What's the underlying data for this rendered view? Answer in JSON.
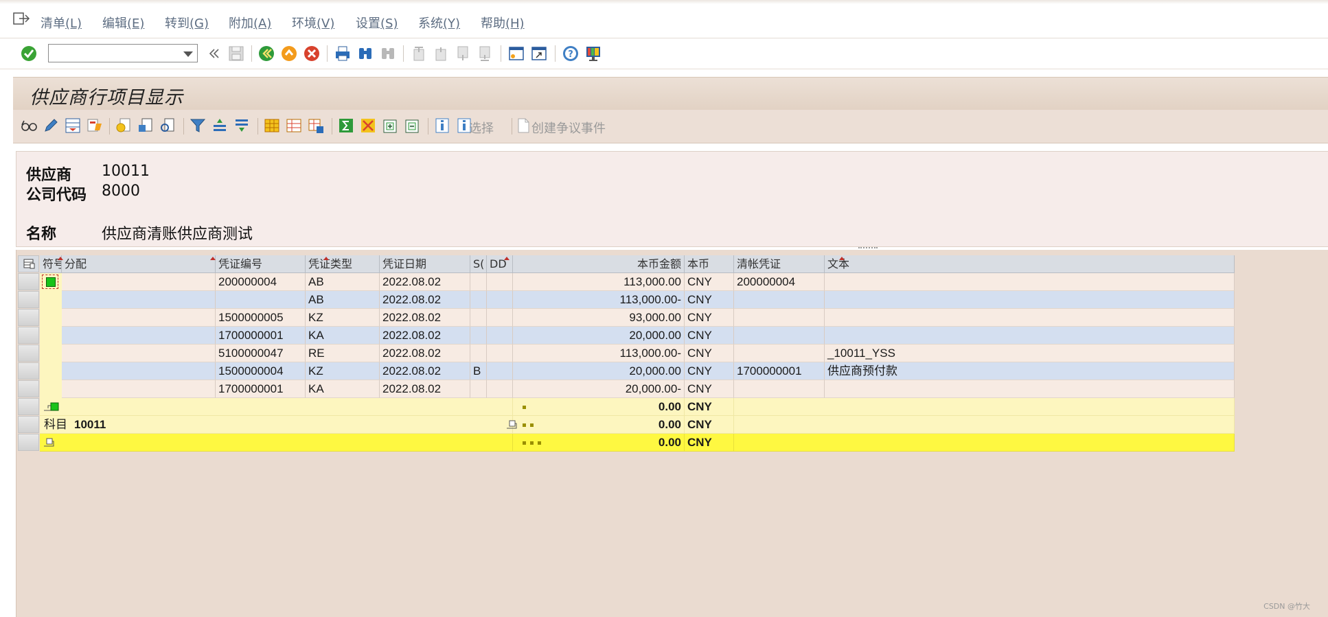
{
  "menu": [
    {
      "label": "清单",
      "key": "(L)"
    },
    {
      "label": "编辑",
      "key": "(E)"
    },
    {
      "label": "转到",
      "key": "(G)"
    },
    {
      "label": "附加",
      "key": "(A)"
    },
    {
      "label": "环境",
      "key": "(V)"
    },
    {
      "label": "设置",
      "key": "(S)"
    },
    {
      "label": "系统",
      "key": "(Y)"
    },
    {
      "label": "帮助",
      "key": "(H)"
    }
  ],
  "command_field": {
    "value": ""
  },
  "title": "供应商行项目显示",
  "app_toolbar": {
    "select_label": "选择",
    "dispute_label": "创建争议事件"
  },
  "header": {
    "vendor_label": "供应商",
    "vendor_value": "10011",
    "company_label": "公司代码",
    "company_value": "8000",
    "name_label": "名称",
    "name_value": "供应商清账供应商测试"
  },
  "columns": [
    "符号",
    "分配",
    "凭证编号",
    "凭证类型",
    "凭证日期",
    "S(",
    "DD",
    "本币金额",
    "本币",
    "清帐凭证",
    "文本"
  ],
  "rows": [
    {
      "doc": "200000004",
      "type": "AB",
      "date": "2022.08.02",
      "s": "",
      "dd": "",
      "amount": "113,000.00",
      "cur": "CNY",
      "clear": "200000004",
      "text": ""
    },
    {
      "doc": "",
      "type": "AB",
      "date": "2022.08.02",
      "s": "",
      "dd": "",
      "amount": "113,000.00-",
      "cur": "CNY",
      "clear": "",
      "text": ""
    },
    {
      "doc": "1500000005",
      "type": "KZ",
      "date": "2022.08.02",
      "s": "",
      "dd": "",
      "amount": "93,000.00",
      "cur": "CNY",
      "clear": "",
      "text": ""
    },
    {
      "doc": "1700000001",
      "type": "KA",
      "date": "2022.08.02",
      "s": "",
      "dd": "",
      "amount": "20,000.00",
      "cur": "CNY",
      "clear": "",
      "text": ""
    },
    {
      "doc": "5100000047",
      "type": "RE",
      "date": "2022.08.02",
      "s": "",
      "dd": "",
      "amount": "113,000.00-",
      "cur": "CNY",
      "clear": "",
      "text": "_10011_YSS"
    },
    {
      "doc": "1500000004",
      "type": "KZ",
      "date": "2022.08.02",
      "s": "B",
      "dd": "",
      "amount": "20,000.00",
      "cur": "CNY",
      "clear": "1700000001",
      "text": "供应商预付款"
    },
    {
      "doc": "1700000001",
      "type": "KA",
      "date": "2022.08.02",
      "s": "",
      "dd": "",
      "amount": "20,000.00-",
      "cur": "CNY",
      "clear": "",
      "text": ""
    }
  ],
  "subtotal": {
    "amount": "0.00",
    "cur": "CNY"
  },
  "account_total": {
    "label": "科目",
    "account": "10011",
    "amount": "0.00",
    "cur": "CNY"
  },
  "grand_total": {
    "amount": "0.00",
    "cur": "CNY"
  },
  "watermark": "CSDN @竹大",
  "colors": {
    "title_bg": "#e2d2c4",
    "row_alt": "#d4dff0",
    "row": "#f7ebe3",
    "subtotal": "#fdf6bf",
    "total": "#fef841",
    "status_green": "#19c319"
  }
}
